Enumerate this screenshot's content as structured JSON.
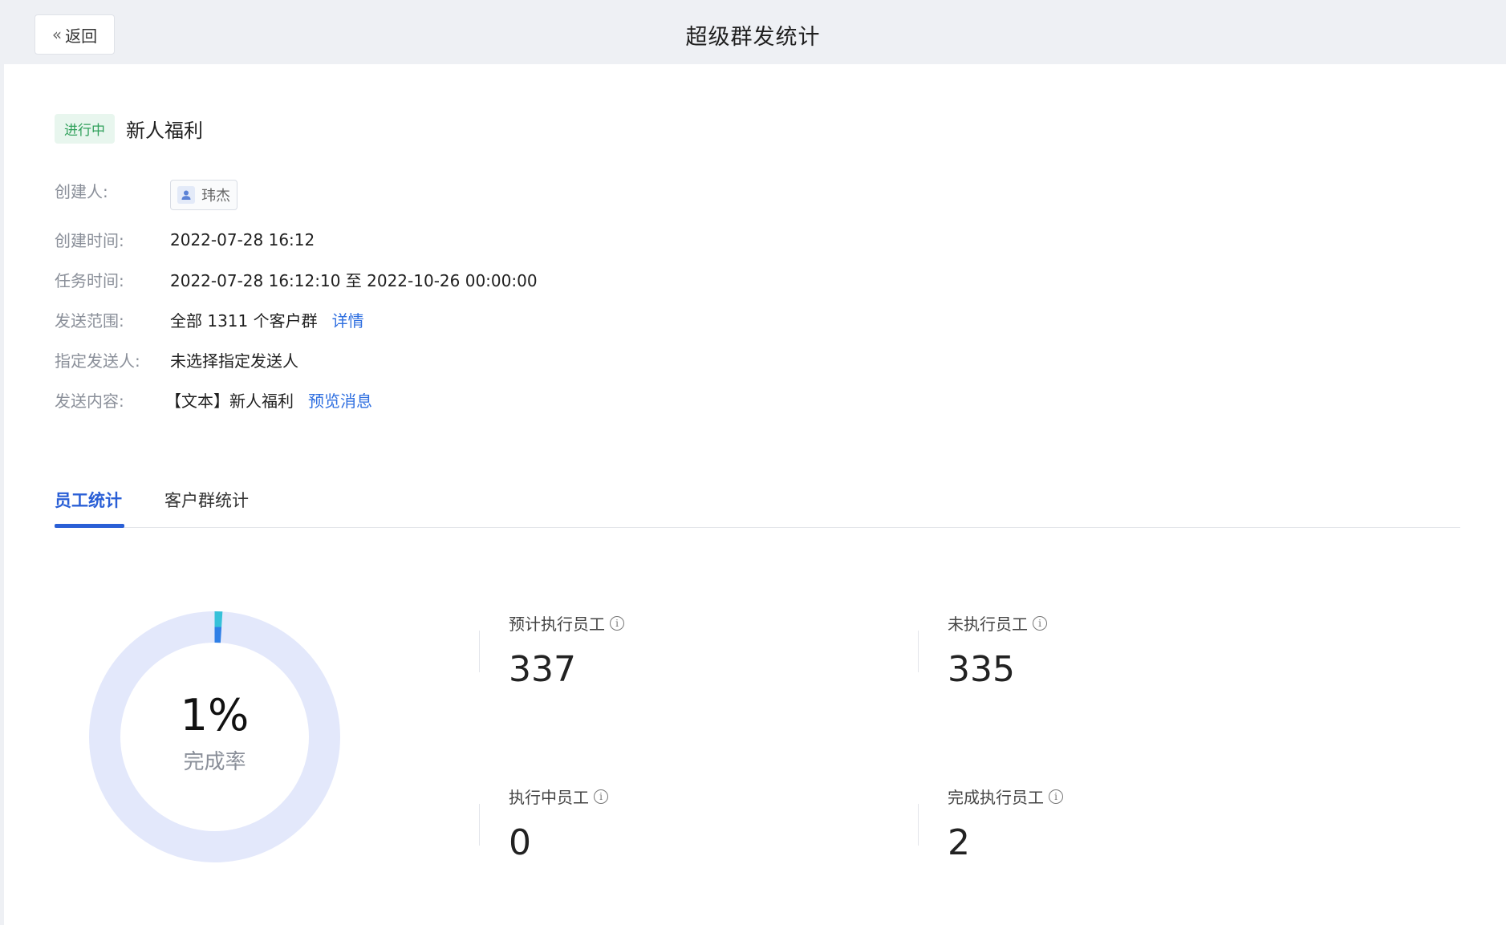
{
  "header": {
    "back_label": "返回",
    "title": "超级群发统计"
  },
  "task": {
    "status": "进行中",
    "name": "新人福利"
  },
  "info": {
    "creator_label": "创建人:",
    "creator_name": "玮杰",
    "created_time_label": "创建时间:",
    "created_time": "2022-07-28 16:12",
    "task_time_label": "任务时间:",
    "task_time": "2022-07-28 16:12:10 至 2022-10-26 00:00:00",
    "scope_label": "发送范围:",
    "scope_value": "全部 1311 个客户群",
    "scope_link": "详情",
    "sender_label": "指定发送人:",
    "sender_value": "未选择指定发送人",
    "content_label": "发送内容:",
    "content_value": "【文本】新人福利",
    "content_link": "预览消息"
  },
  "tabs": [
    {
      "label": "员工统计",
      "active": true
    },
    {
      "label": "客户群统计",
      "active": false
    }
  ],
  "completion": {
    "rate_text": "1%",
    "rate_fraction": 0.01,
    "label": "完成率",
    "track_color": "#e3e8fb",
    "progress_color_start": "#36c1d9",
    "progress_color_end": "#2f7fe6"
  },
  "stats": [
    {
      "label": "预计执行员工",
      "value": "337"
    },
    {
      "label": "未执行员工",
      "value": "335"
    },
    {
      "label": "执行中员工",
      "value": "0"
    },
    {
      "label": "完成执行员工",
      "value": "2"
    }
  ],
  "colors": {
    "accent": "#2a5fd6",
    "link": "#2f6fe0",
    "status_bg": "#e8f6ee",
    "status_text": "#2fa05a"
  }
}
